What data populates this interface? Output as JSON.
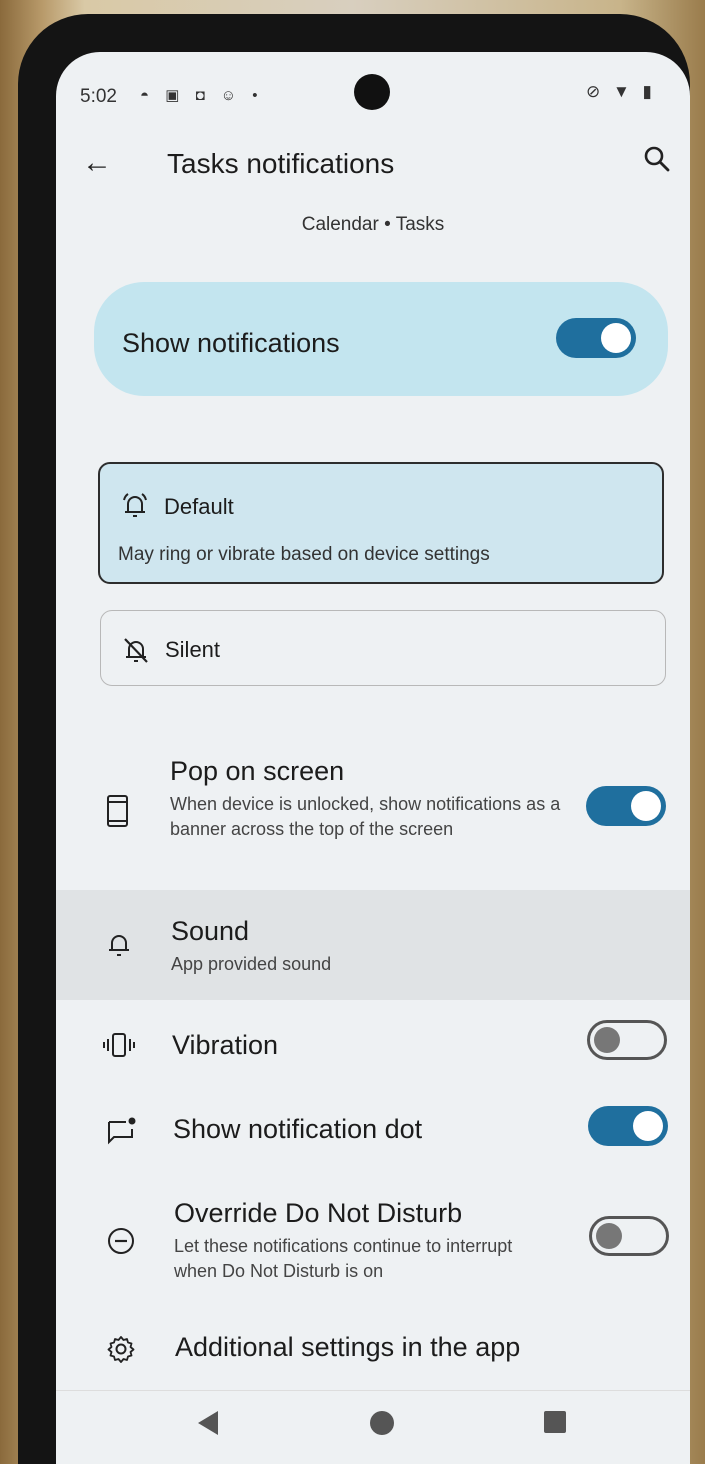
{
  "status_bar": {
    "time": "5:02",
    "left_icons": "◓ ▣ ◘ ☺ •",
    "right_icons": "⊘ ▼ ▮"
  },
  "app_bar": {
    "title": "Tasks notifications",
    "subtitle": "Calendar • Tasks",
    "back_icon": "←"
  },
  "show_notifications": {
    "label": "Show notifications",
    "enabled": true
  },
  "alert_options": [
    {
      "label": "Default",
      "description": "May ring or vibrate based on device settings",
      "selected": true
    },
    {
      "label": "Silent",
      "selected": false
    }
  ],
  "settings": {
    "pop_on_screen": {
      "title": "Pop on screen",
      "description": "When device is unlocked, show notifications as a banner across the top of the screen",
      "enabled": true
    },
    "sound": {
      "title": "Sound",
      "description": "App provided sound"
    },
    "vibration": {
      "title": "Vibration",
      "enabled": false
    },
    "notification_dot": {
      "title": "Show notification dot",
      "enabled": true
    },
    "override_dnd": {
      "title": "Override Do Not Disturb",
      "description": "Let these notifications continue to interrupt when Do Not Disturb is on",
      "enabled": false
    },
    "additional": {
      "title": "Additional settings in the app"
    }
  },
  "colors": {
    "accent": "#1f6f9e",
    "highlight": "#c3e5ef",
    "screen_bg": "#eef1f3"
  }
}
